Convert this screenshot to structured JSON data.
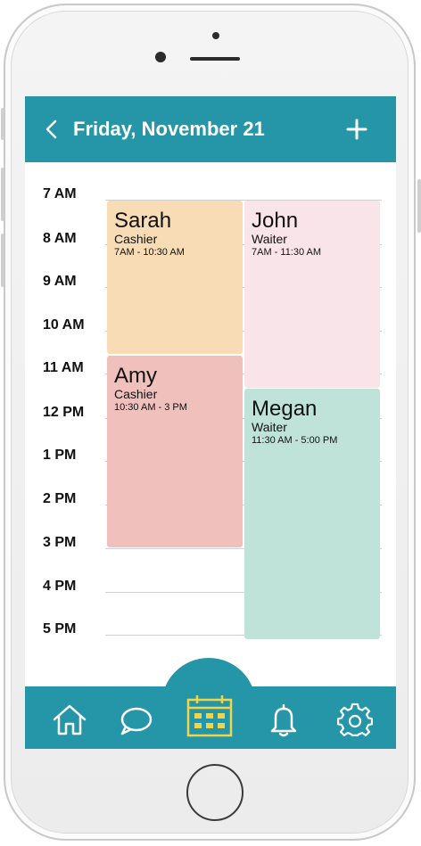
{
  "header": {
    "title": "Friday, November 21",
    "back_icon": "chevron-left-icon",
    "add_icon": "plus-icon"
  },
  "timeline": {
    "hours": [
      "7 AM",
      "8 AM",
      "9 AM",
      "10 AM",
      "11 AM",
      "12 PM",
      "1 PM",
      "2 PM",
      "3 PM",
      "4 PM",
      "5 PM"
    ]
  },
  "shifts": [
    {
      "name": "Sarah",
      "role": "Cashier",
      "hours": "7AM - 10:30 AM",
      "color": "#f7dcb5"
    },
    {
      "name": "John",
      "role": "Waiter",
      "hours": "7AM - 11:30 AM",
      "color": "#f9e4ea"
    },
    {
      "name": "Amy",
      "role": "Cashier",
      "hours": "10:30 AM - 3 PM",
      "color": "#f0c0bd"
    },
    {
      "name": "Megan",
      "role": "Waiter",
      "hours": "11:30 AM - 5:00 PM",
      "color": "#bfe3d8"
    }
  ],
  "nav": {
    "items": [
      {
        "icon": "home-icon"
      },
      {
        "icon": "chat-icon"
      },
      {
        "icon": "calendar-icon",
        "active": true
      },
      {
        "icon": "bell-icon"
      },
      {
        "icon": "gear-icon"
      }
    ],
    "accent": "#2596a8",
    "active_color": "#f0d44a"
  }
}
